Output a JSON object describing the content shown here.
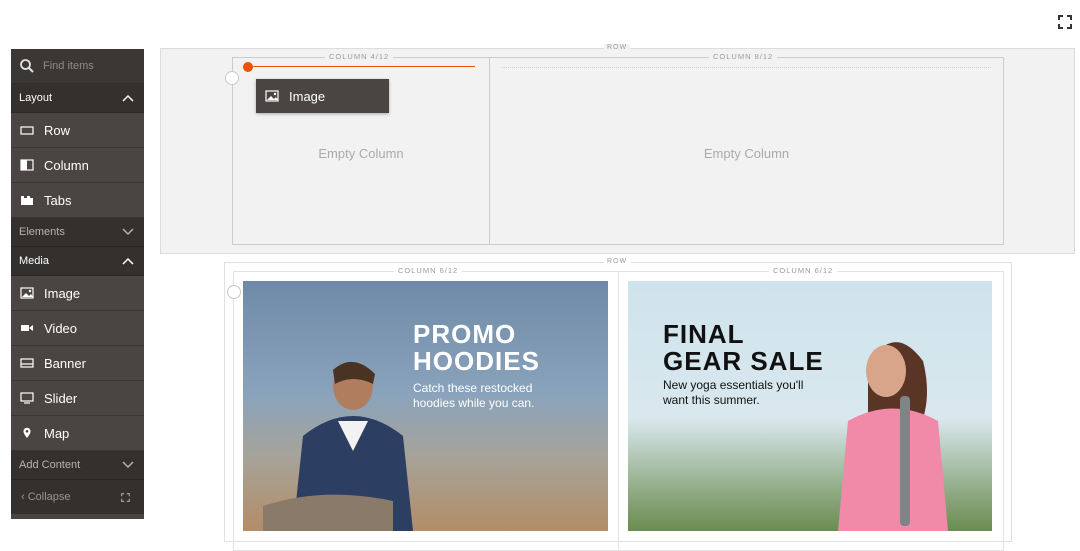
{
  "toolbar": {
    "fullscreen_icon": "expand-icon"
  },
  "panel": {
    "search_placeholder": "Find items",
    "groups": [
      {
        "label": "Layout",
        "state": "expanded",
        "items": [
          {
            "label": "Row",
            "icon": "row-icon"
          },
          {
            "label": "Column",
            "icon": "column-icon"
          },
          {
            "label": "Tabs",
            "icon": "tabs-icon"
          }
        ]
      },
      {
        "label": "Elements",
        "state": "collapsed",
        "items": []
      },
      {
        "label": "Media",
        "state": "expanded",
        "items": [
          {
            "label": "Image",
            "icon": "image-icon"
          },
          {
            "label": "Video",
            "icon": "video-icon"
          },
          {
            "label": "Banner",
            "icon": "banner-icon"
          },
          {
            "label": "Slider",
            "icon": "slider-icon"
          },
          {
            "label": "Map",
            "icon": "map-pin-icon"
          }
        ]
      },
      {
        "label": "Add Content",
        "state": "collapsed",
        "items": []
      }
    ],
    "collapse_label": "Collapse"
  },
  "stage": {
    "row1": {
      "label": "ROW",
      "columns": [
        {
          "label": "COLUMN 4/12",
          "empty_text": "Empty Column"
        },
        {
          "label": "COLUMN 8/12",
          "empty_text": "Empty Column"
        }
      ],
      "drag_item": {
        "label": "Image",
        "icon": "image-icon"
      }
    },
    "row2": {
      "label": "ROW",
      "columns": [
        {
          "label": "COLUMN 6/12",
          "banner": {
            "title_line1": "PROMO",
            "title_line2": "HOODIES",
            "sub_line1": "Catch these restocked",
            "sub_line2": "hoodies while you can."
          }
        },
        {
          "label": "COLUMN 6/12",
          "banner": {
            "title_line1": "FINAL",
            "title_line2": "GEAR SALE",
            "sub_line1": "New yoga essentials you'll",
            "sub_line2": "want this summer."
          }
        }
      ]
    }
  },
  "colors": {
    "accent": "#eb5202",
    "panel_bg": "#4a4542",
    "stage_bg": "#f2f2f2"
  }
}
